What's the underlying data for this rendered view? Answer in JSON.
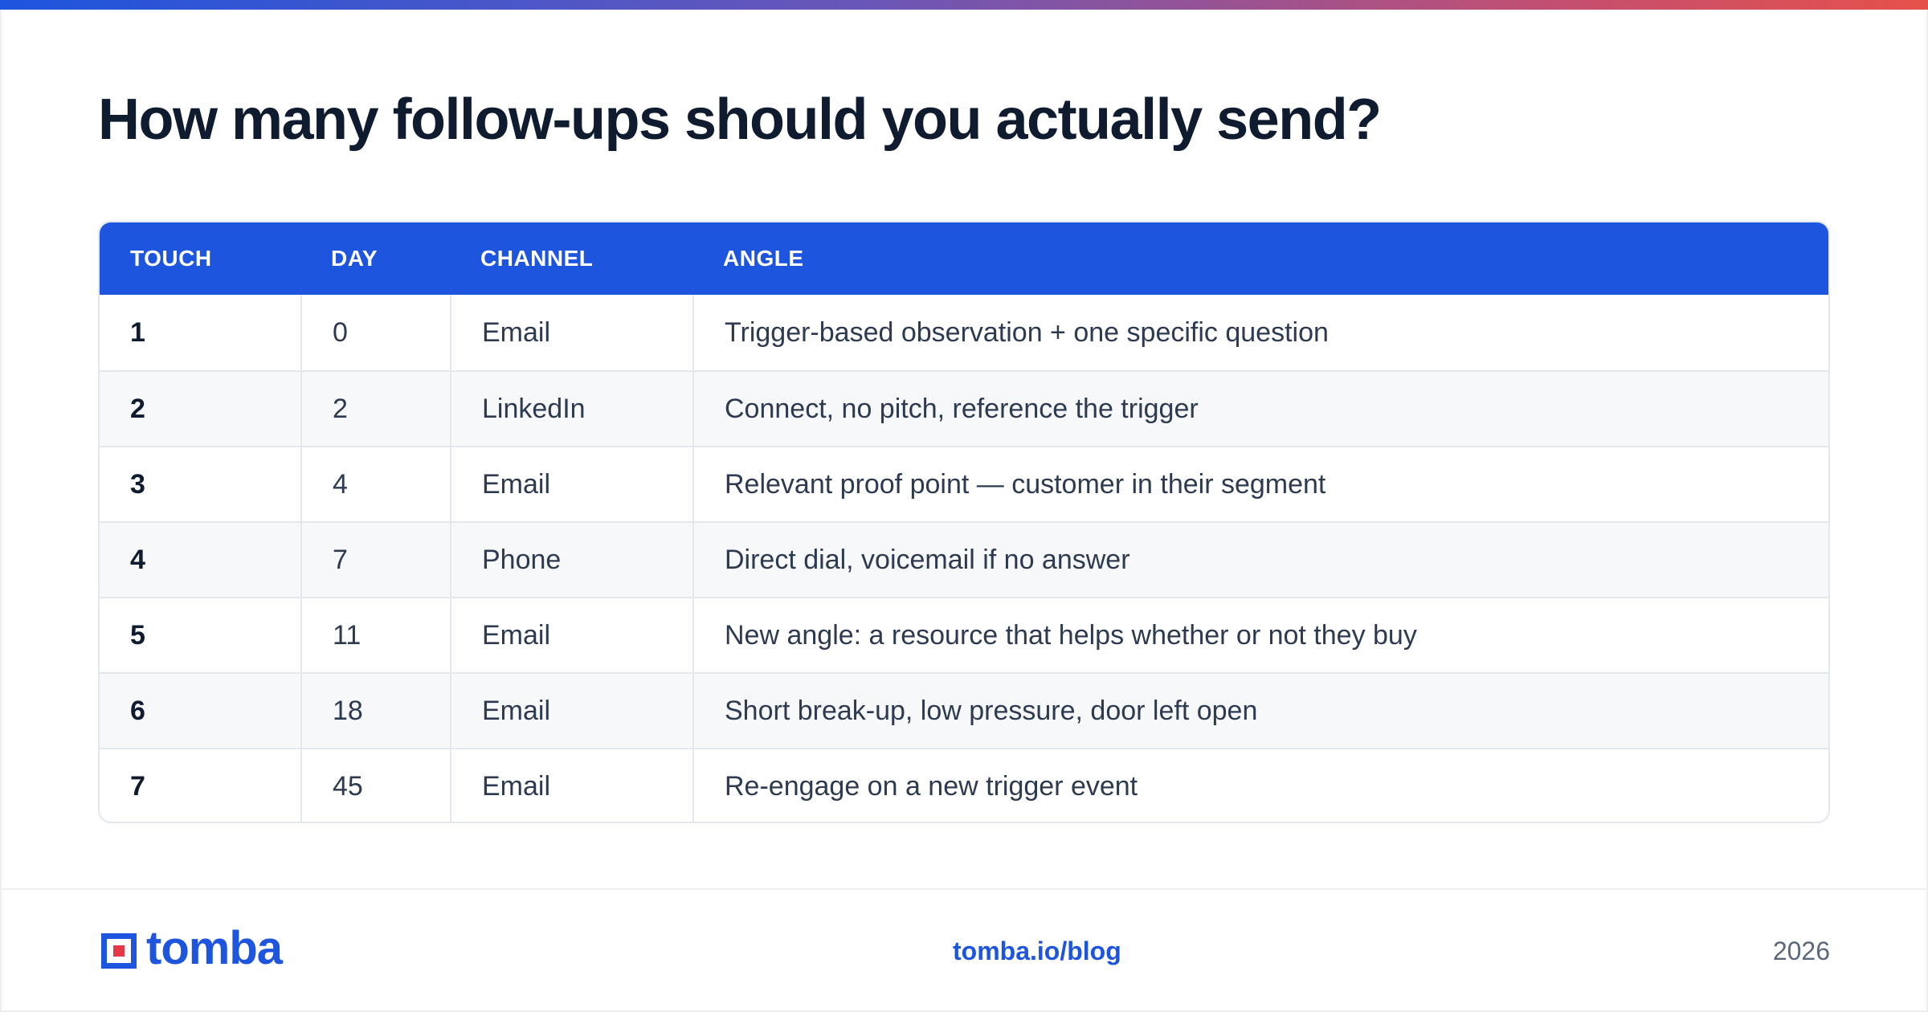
{
  "page": {
    "title": "How many follow-ups should you actually send?"
  },
  "table": {
    "headers": [
      "TOUCH",
      "DAY",
      "CHANNEL",
      "ANGLE"
    ],
    "rows": [
      {
        "touch": "1",
        "day": "0",
        "channel": "Email",
        "angle": "Trigger-based observation + one specific question"
      },
      {
        "touch": "2",
        "day": "2",
        "channel": "LinkedIn",
        "angle": "Connect, no pitch, reference the trigger"
      },
      {
        "touch": "3",
        "day": "4",
        "channel": "Email",
        "angle": "Relevant proof point — customer in their segment"
      },
      {
        "touch": "4",
        "day": "7",
        "channel": "Phone",
        "angle": "Direct dial, voicemail if no answer"
      },
      {
        "touch": "5",
        "day": "11",
        "channel": "Email",
        "angle": "New angle: a resource that helps whether or not they buy"
      },
      {
        "touch": "6",
        "day": "18",
        "channel": "Email",
        "angle": "Short break-up, low pressure, door left open"
      },
      {
        "touch": "7",
        "day": "45",
        "channel": "Email",
        "angle": "Re-engage on a new trigger event"
      }
    ]
  },
  "footer": {
    "logo_text": "tomba",
    "logo_icon": "tomba-logo-icon",
    "link": "tomba.io/blog",
    "year": "2026"
  },
  "colors": {
    "accent": "#1d55de",
    "gradient_end": "#e6504a",
    "logo_red": "#e63946",
    "title": "#0f1b2e"
  }
}
